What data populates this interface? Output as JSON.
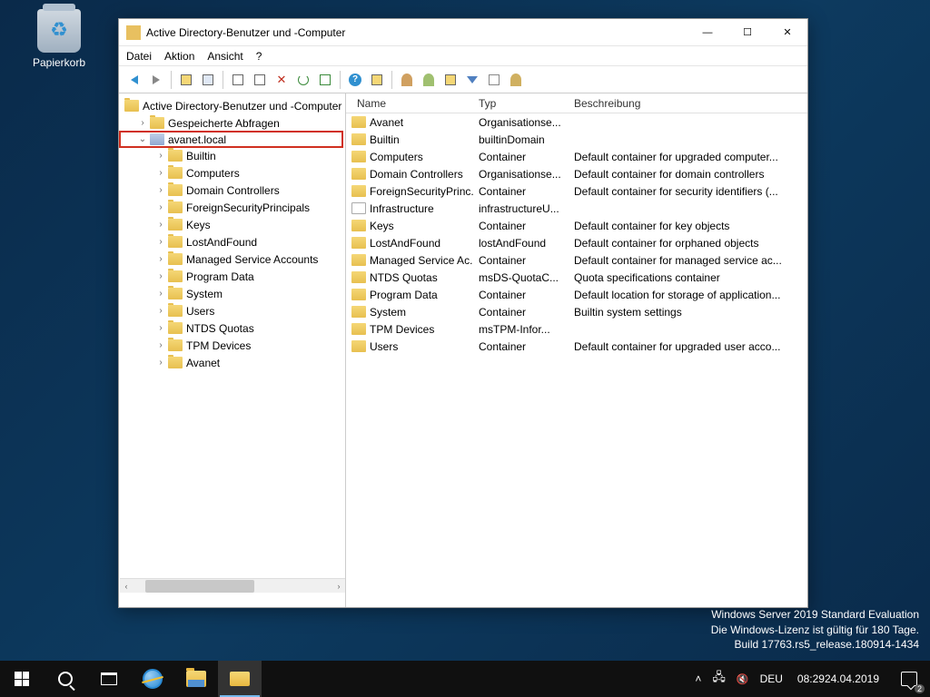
{
  "desktop": {
    "recycle_bin": "Papierkorb"
  },
  "window": {
    "title": "Active Directory-Benutzer und -Computer",
    "controls": {
      "min": "—",
      "max": "☐",
      "close": "✕"
    }
  },
  "menu": {
    "datei": "Datei",
    "aktion": "Aktion",
    "ansicht": "Ansicht",
    "help": "?"
  },
  "tree": {
    "root": "Active Directory-Benutzer und -Computer",
    "saved_queries": "Gespeicherte Abfragen",
    "domain": "avanet.local",
    "children": [
      "Builtin",
      "Computers",
      "Domain Controllers",
      "ForeignSecurityPrincipals",
      "Keys",
      "LostAndFound",
      "Managed Service Accounts",
      "Program Data",
      "System",
      "Users",
      "NTDS Quotas",
      "TPM Devices",
      "Avanet"
    ]
  },
  "list": {
    "headers": {
      "name": "Name",
      "type": "Typ",
      "desc": "Beschreibung"
    },
    "rows": [
      {
        "name": "Avanet",
        "type": "Organisationse...",
        "desc": "",
        "icon": "ou"
      },
      {
        "name": "Builtin",
        "type": "builtinDomain",
        "desc": "",
        "icon": "folder"
      },
      {
        "name": "Computers",
        "type": "Container",
        "desc": "Default container for upgraded computer...",
        "icon": "folder"
      },
      {
        "name": "Domain Controllers",
        "type": "Organisationse...",
        "desc": "Default container for domain controllers",
        "icon": "ou"
      },
      {
        "name": "ForeignSecurityPrinc...",
        "type": "Container",
        "desc": "Default container for security identifiers (...",
        "icon": "folder"
      },
      {
        "name": "Infrastructure",
        "type": "infrastructureU...",
        "desc": "",
        "icon": "doc"
      },
      {
        "name": "Keys",
        "type": "Container",
        "desc": "Default container for key objects",
        "icon": "folder"
      },
      {
        "name": "LostAndFound",
        "type": "lostAndFound",
        "desc": "Default container for orphaned objects",
        "icon": "folder"
      },
      {
        "name": "Managed Service Ac...",
        "type": "Container",
        "desc": "Default container for managed service ac...",
        "icon": "folder"
      },
      {
        "name": "NTDS Quotas",
        "type": "msDS-QuotaC...",
        "desc": "Quota specifications container",
        "icon": "folder"
      },
      {
        "name": "Program Data",
        "type": "Container",
        "desc": "Default location for storage of application...",
        "icon": "folder"
      },
      {
        "name": "System",
        "type": "Container",
        "desc": "Builtin system settings",
        "icon": "folder"
      },
      {
        "name": "TPM Devices",
        "type": "msTPM-Infor...",
        "desc": "",
        "icon": "folder"
      },
      {
        "name": "Users",
        "type": "Container",
        "desc": "Default container for upgraded user acco...",
        "icon": "folder"
      }
    ]
  },
  "watermark": {
    "l1": "Windows Server 2019 Standard Evaluation",
    "l2": "Die Windows-Lizenz ist gültig für 180 Tage.",
    "l3": "Build 17763.rs5_release.180914-1434"
  },
  "tray": {
    "lang": "DEU",
    "time": "08:29",
    "date": "24.04.2019",
    "notif_count": "2"
  }
}
